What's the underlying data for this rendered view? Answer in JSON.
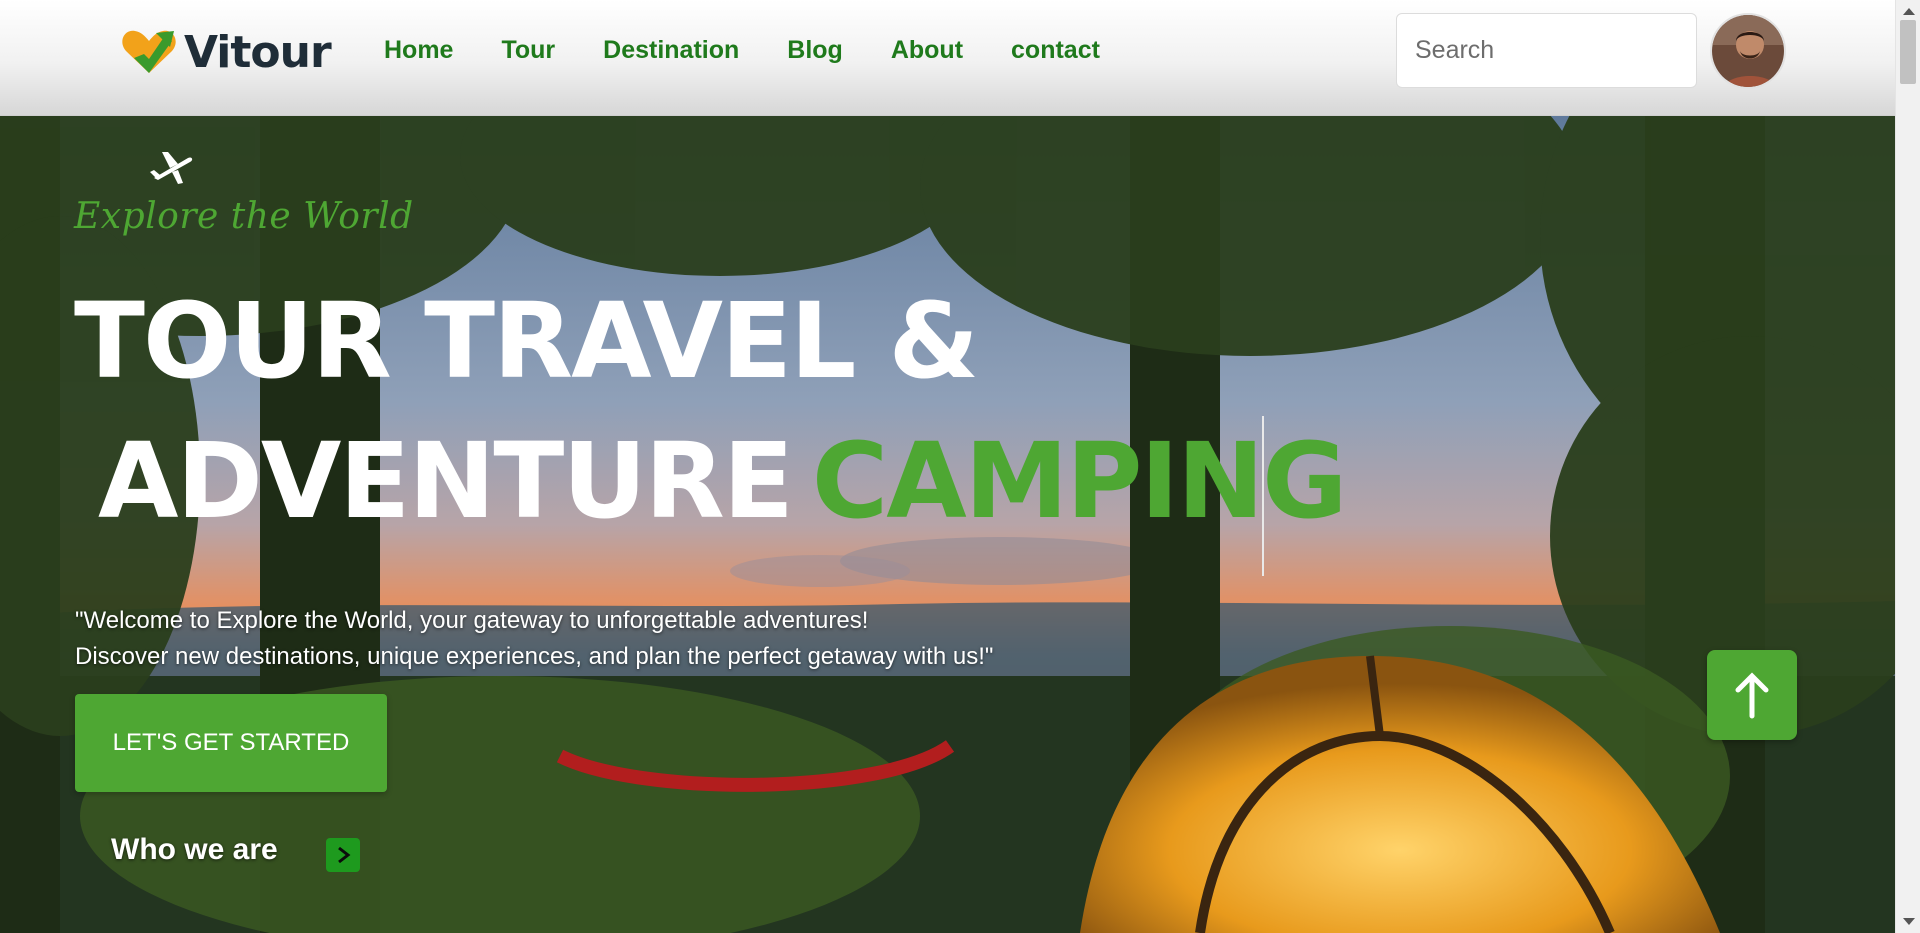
{
  "brand": {
    "name": "Vitour",
    "icon": "heart-arrow-logo-icon",
    "accent": "#4ea733",
    "nav_color": "#1f7a1c"
  },
  "nav": {
    "items": [
      {
        "label": "Home"
      },
      {
        "label": "Tour"
      },
      {
        "label": "Destination"
      },
      {
        "label": "Blog"
      },
      {
        "label": "About"
      },
      {
        "label": "contact"
      }
    ]
  },
  "search": {
    "placeholder": "Search",
    "value": ""
  },
  "profile": {
    "icon": "user-avatar-icon"
  },
  "hero": {
    "tagline": "Explore the World",
    "title_line1": "TOUR TRAVEL &",
    "title_line2_white": "ADVENTURE",
    "title_line2_accent": "CAMPING",
    "welcome_line1": "\"Welcome to Explore the World, your gateway to unforgettable adventures!",
    "welcome_line2": "Discover new destinations, unique experiences, and plan the perfect getaway with us!\"",
    "cta_label": "LET'S GET STARTED",
    "who_label": "Who we are",
    "who_icon": "chevron-right-icon",
    "plane_icon": "airplane-icon",
    "scroll_top_icon": "arrow-up-icon",
    "background": "camping-sunset-photo"
  }
}
